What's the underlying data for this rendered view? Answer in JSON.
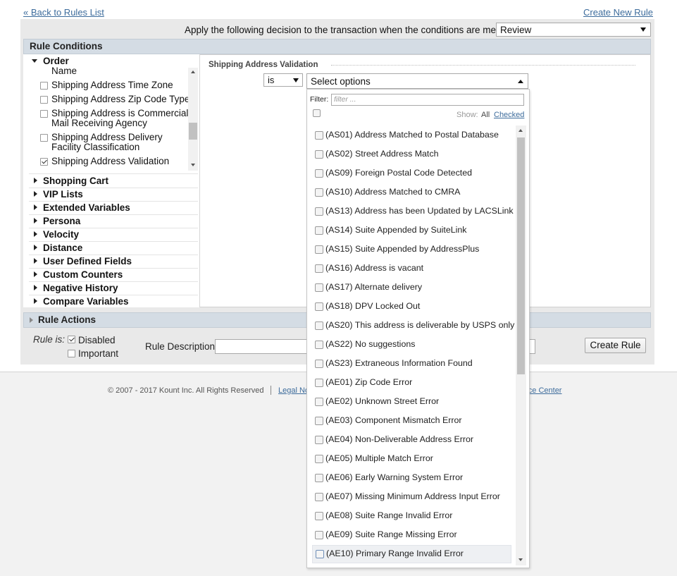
{
  "nav": {
    "back_link": "« Back to Rules List",
    "create_link": "Create New Rule"
  },
  "decision": {
    "label": "Apply the following decision to the transaction when the conditions are met:",
    "value": "Review"
  },
  "conditions": {
    "header": "Rule Conditions",
    "order_label": "Order",
    "order_items": [
      {
        "label": "Name",
        "checked": false
      },
      {
        "label": "Shipping Address Time Zone",
        "checked": false
      },
      {
        "label": "Shipping Address Zip Code Type",
        "checked": false
      },
      {
        "label": "Shipping Address is Commercial",
        "label2": "Mail Receiving Agency",
        "checked": false
      },
      {
        "label": "Shipping Address Delivery",
        "label2": "Facility Classification",
        "checked": false
      },
      {
        "label": "Shipping Address Validation",
        "checked": true
      }
    ],
    "categories": [
      "Shopping Cart",
      "VIP Lists",
      "Extended Variables",
      "Persona",
      "Velocity",
      "Distance",
      "User Defined Fields",
      "Custom Counters",
      "Negative History",
      "Compare Variables"
    ]
  },
  "field": {
    "title": "Shipping Address Validation",
    "operator": "is",
    "select_placeholder": "Select options"
  },
  "dropdown": {
    "filter_label": "Filter:",
    "filter_placeholder": "filter ...",
    "show_label": "Show:",
    "show_all": "All",
    "show_checked": "Checked",
    "options": [
      "(AS01) Address Matched to Postal Database",
      "(AS02) Street Address Match",
      "(AS09) Foreign Postal Code Detected",
      "(AS10) Address Matched to CMRA",
      "(AS13) Address has been Updated by LACSLink",
      "(AS14) Suite Appended by SuiteLink",
      "(AS15) Suite Appended by AddressPlus",
      "(AS16) Address is vacant",
      "(AS17) Alternate delivery",
      "(AS18) DPV Locked Out",
      "(AS20) This address is deliverable by USPS only",
      "(AS22) No suggestions",
      "(AS23) Extraneous Information Found",
      "(AE01) Zip Code Error",
      "(AE02) Unknown Street Error",
      "(AE03) Component Mismatch Error",
      "(AE04) Non-Deliverable Address Error",
      "(AE05) Multiple Match Error",
      "(AE06) Early Warning System Error",
      "(AE07) Missing Minimum Address Input Error",
      "(AE08) Suite Range Invalid Error",
      "(AE09) Suite Range Missing Error",
      "(AE10) Primary Range Invalid Error"
    ]
  },
  "actions": {
    "header": "Rule Actions",
    "rule_is_label": "Rule is:",
    "disabled_label": "Disabled",
    "important_label": "Important",
    "description_label": "Rule Description:",
    "create_button": "Create Rule"
  },
  "footer": {
    "copyright": "© 2007 - 2017 Kount Inc. All Rights Reserved",
    "legal_link": "Legal No",
    "resource_link": "urce Center"
  }
}
